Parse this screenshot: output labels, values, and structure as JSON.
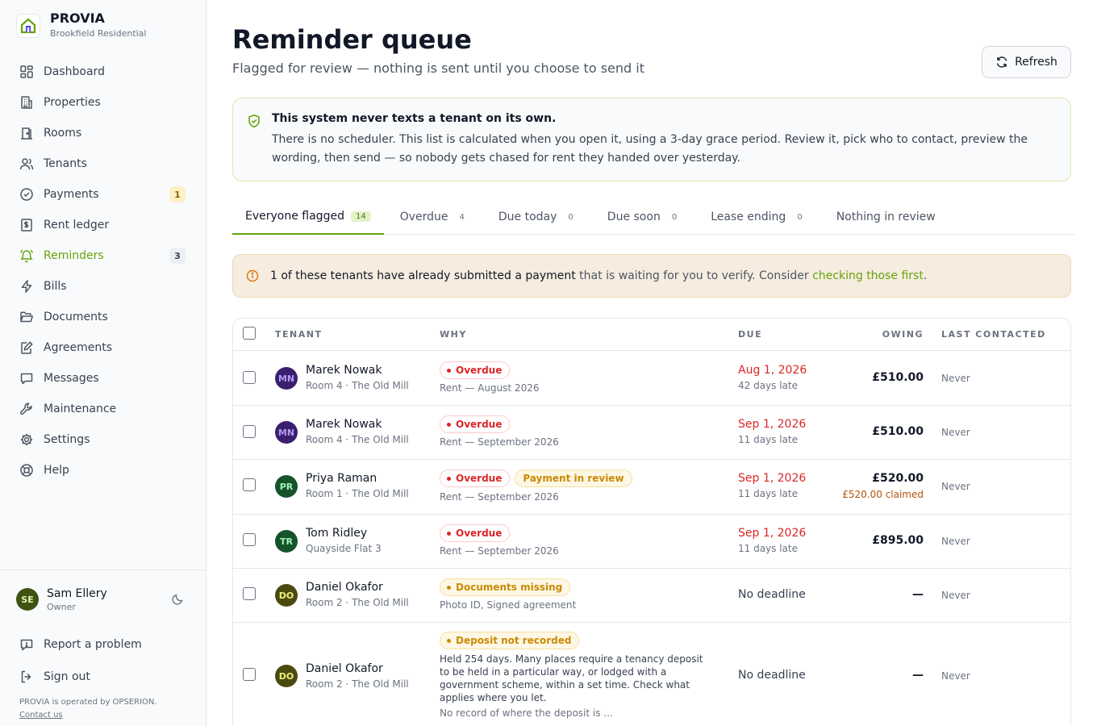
{
  "brand": {
    "name": "PROVIA",
    "subtitle": "Brookfield Residential"
  },
  "nav": [
    {
      "label": "Dashboard",
      "icon": "dashboard-icon",
      "badge": ""
    },
    {
      "label": "Properties",
      "icon": "building-icon",
      "badge": ""
    },
    {
      "label": "Rooms",
      "icon": "door-icon",
      "badge": ""
    },
    {
      "label": "Tenants",
      "icon": "users-icon",
      "badge": ""
    },
    {
      "label": "Payments",
      "icon": "check-circle-icon",
      "badge": "1"
    },
    {
      "label": "Rent ledger",
      "icon": "ledger-icon",
      "badge": ""
    },
    {
      "label": "Reminders",
      "icon": "bell-icon",
      "badge": "3",
      "active": true
    },
    {
      "label": "Bills",
      "icon": "bolt-icon",
      "badge": ""
    },
    {
      "label": "Documents",
      "icon": "folder-icon",
      "badge": ""
    },
    {
      "label": "Agreements",
      "icon": "pen-icon",
      "badge": ""
    },
    {
      "label": "Messages",
      "icon": "message-icon",
      "badge": ""
    },
    {
      "label": "Maintenance",
      "icon": "wrench-icon",
      "badge": ""
    },
    {
      "label": "Settings",
      "icon": "gear-icon",
      "badge": ""
    },
    {
      "label": "Help",
      "icon": "lifebuoy-icon",
      "badge": ""
    }
  ],
  "user": {
    "initials": "SE",
    "name": "Sam Ellery",
    "role": "Owner"
  },
  "footer": {
    "report": "Report a problem",
    "signout": "Sign out",
    "operated": "PROVIA is operated by OPSERION.",
    "contact": "Contact us"
  },
  "page": {
    "title": "Reminder queue",
    "subtitle": "Flagged for review — nothing is sent until you choose to send it",
    "refresh": "Refresh"
  },
  "info": {
    "title": "This system never texts a tenant on its own.",
    "body": "There is no scheduler. This list is calculated when you open it, using a 3-day grace period. Review it, pick who to contact, preview the wording, then send — so nobody gets chased for rent they handed over yesterday."
  },
  "tabs": [
    {
      "label": "Everyone flagged",
      "count": "14"
    },
    {
      "label": "Overdue",
      "count": "4"
    },
    {
      "label": "Due today",
      "count": "0"
    },
    {
      "label": "Due soon",
      "count": "0"
    },
    {
      "label": "Lease ending",
      "count": "0"
    },
    {
      "label": "Nothing in review",
      "count": ""
    }
  ],
  "notice": {
    "strong": "1 of these tenants have already submitted a payment",
    "middle": " that is waiting for you to verify. Consider ",
    "link": "checking those first",
    "end": "."
  },
  "table": {
    "headers": {
      "tenant": "TENANT",
      "why": "WHY",
      "due": "DUE",
      "owing": "OWING",
      "last": "LAST CONTACTED"
    },
    "rows": [
      {
        "initials": "MN",
        "name": "Marek Nowak",
        "sub": "Room 4 · The Old Mill",
        "pills": [
          "Overdue"
        ],
        "why_sub": "Rent — August 2026",
        "due": "Aug 1, 2026",
        "due_sub": "42 days late",
        "owing": "£510.00",
        "owing_sub": "",
        "last": "Never"
      },
      {
        "initials": "MN",
        "name": "Marek Nowak",
        "sub": "Room 4 · The Old Mill",
        "pills": [
          "Overdue"
        ],
        "why_sub": "Rent — September 2026",
        "due": "Sep 1, 2026",
        "due_sub": "11 days late",
        "owing": "£510.00",
        "owing_sub": "",
        "last": "Never"
      },
      {
        "initials": "PR",
        "name": "Priya Raman",
        "sub": "Room 1 · The Old Mill",
        "pills": [
          "Overdue",
          "Payment in review"
        ],
        "why_sub": "Rent — September 2026",
        "due": "Sep 1, 2026",
        "due_sub": "11 days late",
        "owing": "£520.00",
        "owing_sub": "£520.00 claimed",
        "last": "Never"
      },
      {
        "initials": "TR",
        "name": "Tom Ridley",
        "sub": "Quayside Flat 3",
        "pills": [
          "Overdue"
        ],
        "why_sub": "Rent — September 2026",
        "due": "Sep 1, 2026",
        "due_sub": "11 days late",
        "owing": "£895.00",
        "owing_sub": "",
        "last": "Never"
      },
      {
        "initials": "DO",
        "name": "Daniel Okafor",
        "sub": "Room 2 · The Old Mill",
        "pills": [
          "Documents missing"
        ],
        "why_sub": "Photo ID, Signed agreement",
        "due": "No deadline",
        "due_sub": "",
        "owing": "—",
        "owing_sub": "",
        "last": "Never"
      },
      {
        "initials": "DO",
        "name": "Daniel Okafor",
        "sub": "Room 2 · The Old Mill",
        "pills": [
          "Deposit not recorded"
        ],
        "why_desc": "Held 254 days. Many places require a tenancy deposit to be held in a particular way, or lodged with a government scheme, within a set time. Check what applies where you let.",
        "why_sub": "No record of where the deposit is ...",
        "due": "No deadline",
        "due_sub": "",
        "owing": "—",
        "owing_sub": "",
        "last": "Never"
      }
    ]
  },
  "colors": {
    "accent": "#65a30d",
    "danger": "#dc2626",
    "warning": "#ca8a04"
  }
}
